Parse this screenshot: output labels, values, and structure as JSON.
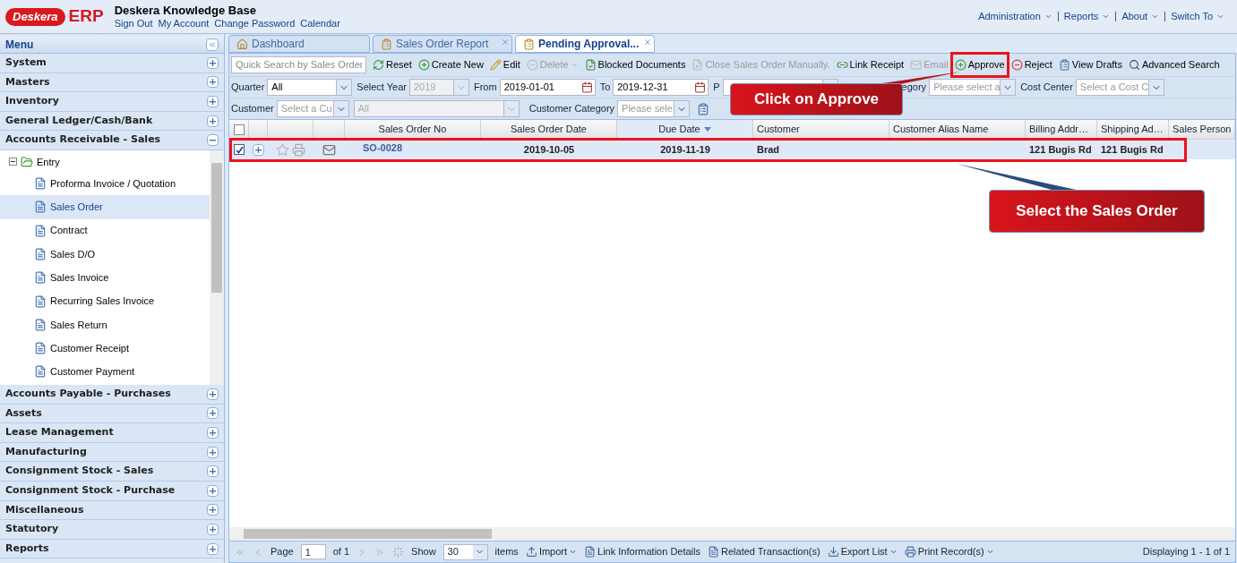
{
  "header": {
    "logo": {
      "brand": "Deskera",
      "product": "ERP"
    },
    "title": "Deskera Knowledge Base",
    "links": [
      "Sign Out",
      "My Account",
      "Change Password",
      "Calendar"
    ],
    "top_menu": [
      "Administration",
      "Reports",
      "About",
      "Switch To"
    ]
  },
  "sidebar": {
    "title": "Menu",
    "sections": [
      {
        "label": "System",
        "expanded": false
      },
      {
        "label": "Masters",
        "expanded": false
      },
      {
        "label": "Inventory",
        "expanded": false
      },
      {
        "label": "General Ledger/Cash/Bank",
        "expanded": false
      },
      {
        "label": "Accounts Receivable - Sales",
        "expanded": true,
        "children": [
          {
            "label": "Entry",
            "expanded": true,
            "children": [
              {
                "label": "Proforma Invoice / Quotation",
                "selected": false
              },
              {
                "label": "Sales Order",
                "selected": true
              },
              {
                "label": "Contract",
                "selected": false
              },
              {
                "label": "Sales D/O",
                "selected": false
              },
              {
                "label": "Sales Invoice",
                "selected": false
              },
              {
                "label": "Recurring Sales Invoice",
                "selected": false
              },
              {
                "label": "Sales Return",
                "selected": false
              },
              {
                "label": "Customer Receipt",
                "selected": false
              },
              {
                "label": "Customer Payment",
                "selected": false
              }
            ]
          }
        ]
      },
      {
        "label": "Accounts Payable - Purchases",
        "expanded": false
      },
      {
        "label": "Assets",
        "expanded": false
      },
      {
        "label": "Lease Management",
        "expanded": false
      },
      {
        "label": "Manufacturing",
        "expanded": false
      },
      {
        "label": "Consignment Stock - Sales",
        "expanded": false
      },
      {
        "label": "Consignment Stock - Purchase",
        "expanded": false
      },
      {
        "label": "Miscellaneous",
        "expanded": false
      },
      {
        "label": "Statutory",
        "expanded": false
      },
      {
        "label": "Reports",
        "expanded": false
      }
    ]
  },
  "tabs": [
    {
      "label": "Dashboard",
      "selected": false,
      "closable": false
    },
    {
      "label": "Sales Order Report",
      "selected": false,
      "closable": true
    },
    {
      "label": "Pending Approval...",
      "selected": true,
      "closable": true
    }
  ],
  "toolbar": {
    "search": {
      "placeholder": "Quick Search by Sales Order"
    },
    "buttons": [
      {
        "label": "Reset",
        "disabled": false,
        "dropdown": false,
        "highlighted": false
      },
      {
        "label": "Create New",
        "disabled": false,
        "dropdown": false,
        "highlighted": false
      },
      {
        "label": "Edit",
        "disabled": false,
        "dropdown": false,
        "highlighted": false
      },
      {
        "label": "Delete",
        "disabled": true,
        "dropdown": true,
        "highlighted": false
      },
      {
        "label": "Blocked Documents",
        "disabled": false,
        "dropdown": false,
        "highlighted": false
      },
      {
        "label": "Close Sales Order Manually.",
        "disabled": true,
        "dropdown": false,
        "highlighted": false
      },
      {
        "label": "Link Receipt",
        "disabled": false,
        "dropdown": false,
        "highlighted": false
      },
      {
        "label": "Email",
        "disabled": true,
        "dropdown": false,
        "highlighted": false
      },
      {
        "label": "Approve",
        "disabled": false,
        "dropdown": false,
        "highlighted": true
      },
      {
        "label": "Reject",
        "disabled": false,
        "dropdown": false,
        "highlighted": false
      },
      {
        "label": "View Drafts",
        "disabled": false,
        "dropdown": false,
        "highlighted": false
      },
      {
        "label": "Advanced Search",
        "disabled": false,
        "dropdown": false,
        "highlighted": false
      }
    ]
  },
  "filters": [
    [
      {
        "label": "Quarter",
        "value": "All",
        "disabled": false,
        "kind": "select"
      },
      {
        "label": "Select Year",
        "value": "2019",
        "disabled": true,
        "kind": "select"
      },
      {
        "label": "From",
        "value": "2019-01-01",
        "disabled": false,
        "kind": "date"
      },
      {
        "label": "To",
        "value": "2019-12-31",
        "disabled": false,
        "kind": "date"
      },
      {
        "label": "P",
        "disabled": false,
        "kind": "select"
      },
      {
        "label": "egory",
        "placeholder": "Please select a",
        "disabled": false,
        "kind": "select"
      },
      {
        "label": "Cost Center",
        "placeholder": "Select a Cost C",
        "disabled": false,
        "kind": "select"
      }
    ],
    [
      {
        "label": "Customer",
        "placeholder": "Select a Cu",
        "disabled": false,
        "kind": "select"
      },
      {
        "value": "All",
        "disabled": true,
        "kind": "select"
      },
      {
        "label": "Customer Category",
        "placeholder": "Please sele",
        "disabled": false,
        "kind": "select"
      },
      {
        "kind": "report-button"
      }
    ]
  ],
  "grid": {
    "all_checked": false,
    "columns": [
      {
        "label": "Sales Order No",
        "sorted": false
      },
      {
        "label": "Sales Order Date",
        "sorted": false
      },
      {
        "label": "Due Date",
        "sorted": true
      },
      {
        "label": "Customer",
        "sorted": false
      },
      {
        "label": "Customer Alias Name",
        "sorted": false
      },
      {
        "label": "Billing Addr…",
        "sorted": false
      },
      {
        "label": "Shipping Ad…",
        "sorted": false
      },
      {
        "label": "Sales Person",
        "sorted": false
      }
    ],
    "rows": [
      {
        "selected": true,
        "checked": true,
        "highlighted": true,
        "cells": [
          "SO-0028",
          "2019-10-05",
          "2019-11-19",
          "Brad",
          "",
          "121 Bugis Rd",
          "121 Bugis Rd",
          ""
        ]
      }
    ]
  },
  "pager": {
    "page_label": "Page",
    "page": "1",
    "of": "of 1",
    "show_label": "Show",
    "page_size": "30",
    "items_label": "items",
    "buttons": [
      {
        "label": "Import",
        "dropdown": true
      },
      {
        "label": "Link Information Details",
        "dropdown": false
      },
      {
        "label": "Related Transaction(s)",
        "dropdown": false
      },
      {
        "label": "Export List",
        "dropdown": true
      },
      {
        "label": "Print Record(s)",
        "dropdown": true
      }
    ],
    "status": "Displaying 1 - 1 of 1"
  },
  "annotations": [
    {
      "text": "Click on Approve"
    },
    {
      "text": "Select the Sales Order"
    }
  ]
}
